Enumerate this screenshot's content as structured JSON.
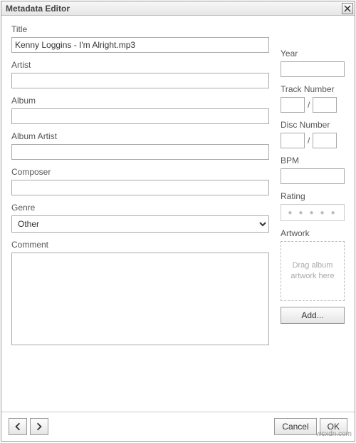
{
  "dialog": {
    "title": "Metadata Editor"
  },
  "fields": {
    "title_label": "Title",
    "title_value": "Kenny Loggins - I'm Alright.mp3",
    "artist_label": "Artist",
    "artist_value": "",
    "album_label": "Album",
    "album_value": "",
    "album_artist_label": "Album Artist",
    "album_artist_value": "",
    "composer_label": "Composer",
    "composer_value": "",
    "genre_label": "Genre",
    "genre_value": "Other",
    "comment_label": "Comment",
    "comment_value": "",
    "year_label": "Year",
    "year_value": "",
    "track_number_label": "Track Number",
    "track_num_value": "",
    "track_total_value": "",
    "track_sep": "/",
    "disc_number_label": "Disc Number",
    "disc_num_value": "",
    "disc_total_value": "",
    "disc_sep": "/",
    "bpm_label": "BPM",
    "bpm_value": "",
    "rating_label": "Rating",
    "artwork_label": "Artwork",
    "artwork_drop_text": "Drag album artwork here",
    "add_button": "Add..."
  },
  "footer": {
    "cancel": "Cancel",
    "ok": "OK"
  },
  "watermark": "wsxdn.com"
}
